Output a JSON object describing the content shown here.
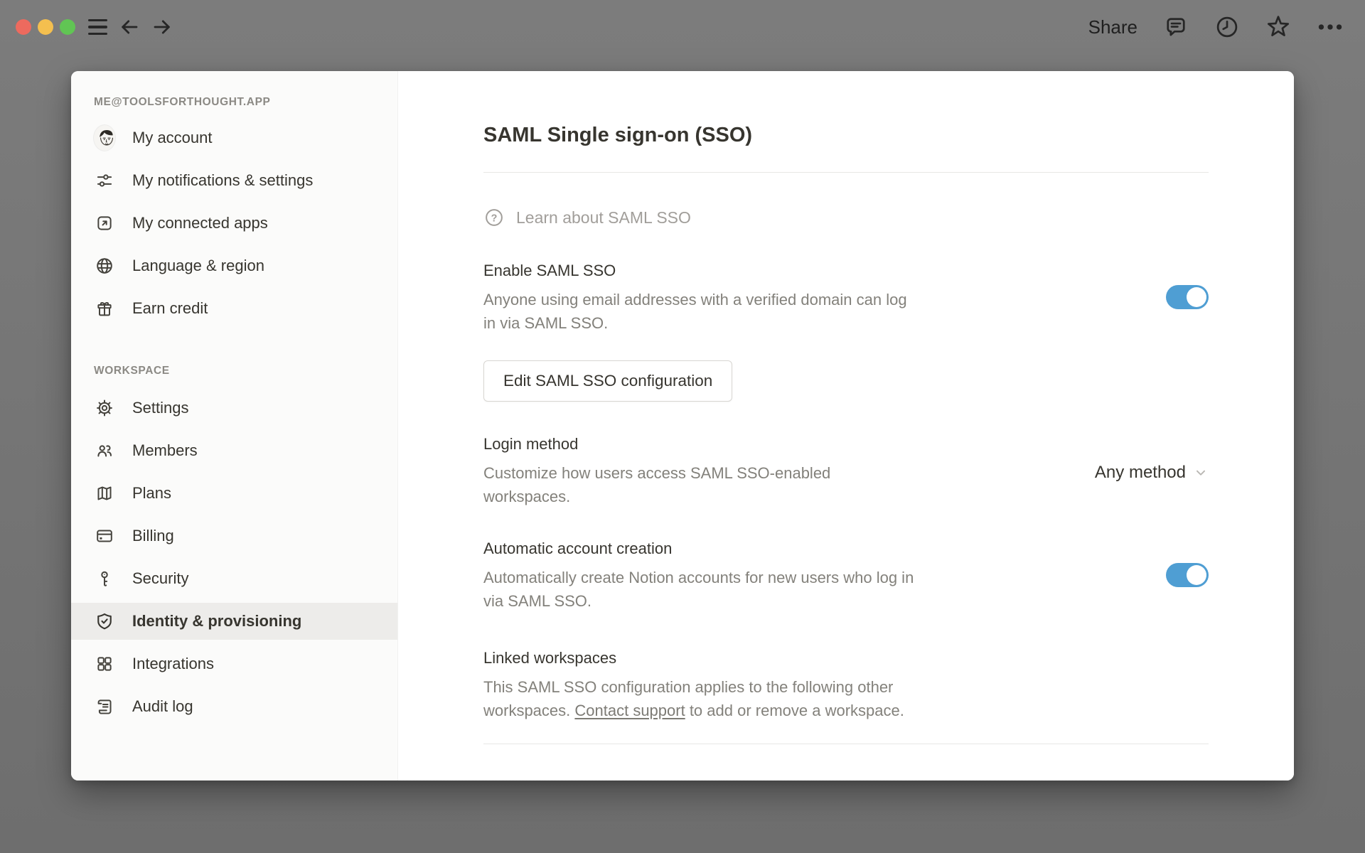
{
  "colors": {
    "toggle_on": "#4f9ed3"
  },
  "titlebar": {
    "share_label": "Share"
  },
  "sidebar": {
    "account_header": "ME@TOOLSFORTHOUGHT.APP",
    "items_account": [
      {
        "label": "My account"
      },
      {
        "label": "My notifications & settings"
      },
      {
        "label": "My connected apps"
      },
      {
        "label": "Language & region"
      },
      {
        "label": "Earn credit"
      }
    ],
    "workspace_header": "WORKSPACE",
    "items_workspace": [
      {
        "label": "Settings"
      },
      {
        "label": "Members"
      },
      {
        "label": "Plans"
      },
      {
        "label": "Billing"
      },
      {
        "label": "Security"
      },
      {
        "label": "Identity & provisioning",
        "active": true
      },
      {
        "label": "Integrations"
      },
      {
        "label": "Audit log"
      }
    ]
  },
  "main": {
    "title": "SAML Single sign-on (SSO)",
    "learn_label": "Learn about SAML SSO",
    "enable": {
      "heading": "Enable SAML SSO",
      "description": "Anyone using email addresses with a verified domain can log in via SAML SSO.",
      "enabled": true
    },
    "edit_button_label": "Edit SAML SSO configuration",
    "login_method": {
      "heading": "Login method",
      "description": "Customize how users access SAML SSO-enabled workspaces.",
      "value": "Any method"
    },
    "auto_account": {
      "heading": "Automatic account creation",
      "description": "Automatically create Notion accounts for new users who log in via SAML SSO.",
      "enabled": true
    },
    "linked_workspaces": {
      "heading": "Linked workspaces",
      "description_before": "This SAML SSO configuration applies to the following other workspaces. ",
      "link_label": "Contact support",
      "description_after": " to add or remove a workspace."
    }
  }
}
